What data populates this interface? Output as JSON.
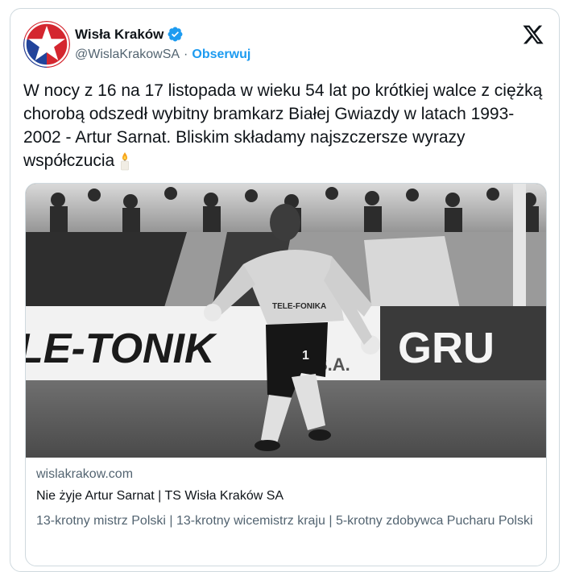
{
  "author": {
    "name": "Wisła Kraków",
    "handle": "@WislaKrakowSA",
    "separator": "·",
    "follow_label": "Obserwuj"
  },
  "tweet": {
    "text": "W nocy z 16 na 17 listopada w wieku 54 lat po krótkiej walce z ciężką chorobą odszedł wybitny bramkarz Białej Gwiazdy w latach 1993-2002 - Artur Sarnat. Bliskim składamy najszczersze wyrazy współczucia"
  },
  "link_card": {
    "domain": "wislakrakow.com",
    "title": "Nie żyje Artur Sarnat | TS Wisła Kraków SA",
    "description": "13-krotny mistrz Polski | 13-krotny wicemistrz kraju | 5-krotny zdobywca Pucharu Polski",
    "photo": {
      "board_text_left": "LE-TONIK",
      "board_text_sa": "S.A.",
      "board_text_right": "GRU",
      "shirt_text": "TELE-FONIKA",
      "shorts_number": "1"
    }
  },
  "icons": [
    "wisla-crest-icon",
    "verified-badge-icon",
    "x-logo-icon",
    "candle-emoji-icon"
  ],
  "colors": {
    "accent": "#1d9bf0",
    "crest_red": "#d4262f",
    "crest_blue": "#21449b"
  }
}
